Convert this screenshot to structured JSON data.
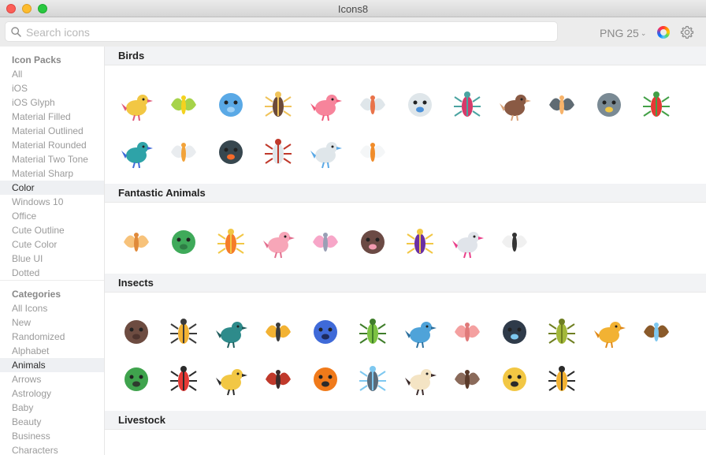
{
  "window": {
    "title": "Icons8"
  },
  "toolbar": {
    "search_placeholder": "Search icons",
    "format_label": "PNG 25",
    "format_chevron": "⌄"
  },
  "sidebar": {
    "icon_packs_header": "Icon Packs",
    "icon_packs": [
      "All",
      "iOS",
      "iOS Glyph",
      "Material Filled",
      "Material Outlined",
      "Material Rounded",
      "Material Two Tone",
      "Material Sharp",
      "Color",
      "Windows 10",
      "Office",
      "Cute Outline",
      "Cute Color",
      "Blue UI",
      "Dotted"
    ],
    "icon_packs_active": "Color",
    "categories_header": "Categories",
    "categories": [
      "All Icons",
      "New",
      "Randomized",
      "Alphabet",
      "Animals",
      "Arrows",
      "Astrology",
      "Baby",
      "Beauty",
      "Business",
      "Characters"
    ],
    "categories_active": "Animals"
  },
  "sections": [
    {
      "title": "Birds",
      "icons": [
        {
          "name": "singing-bird-icon",
          "color": "#f2c744",
          "accent": "#e05a7a"
        },
        {
          "name": "parrot-yellow-icon",
          "color": "#a6d34a",
          "accent": "#f4d21f"
        },
        {
          "name": "dove-icon",
          "color": "#5aa9e6",
          "accent": "#9fd0f5"
        },
        {
          "name": "eagle-icon",
          "color": "#6b4a3a",
          "accent": "#f0c35a"
        },
        {
          "name": "flamingo-icon",
          "color": "#f7849b",
          "accent": "#f05a7a"
        },
        {
          "name": "stork-icon",
          "color": "#dfe6ea",
          "accent": "#e9734a"
        },
        {
          "name": "stork-baby-icon",
          "color": "#dfe6ea",
          "accent": "#4a90d9"
        },
        {
          "name": "hummingbird-icon",
          "color": "#d63a6a",
          "accent": "#4aa3a1"
        },
        {
          "name": "kiwi-icon",
          "color": "#8a5a44",
          "accent": "#d9a37a"
        },
        {
          "name": "ostrich-icon",
          "color": "#5f6b73",
          "accent": "#f7b36a"
        },
        {
          "name": "owl-icon",
          "color": "#7a8a94",
          "accent": "#f2c744"
        },
        {
          "name": "macaw-icon",
          "color": "#e53935",
          "accent": "#43a047"
        },
        {
          "name": "peacock-icon",
          "color": "#2ea3a8",
          "accent": "#3f6ad8"
        },
        {
          "name": "pelican-icon",
          "color": "#e9ecef",
          "accent": "#f2a33a"
        },
        {
          "name": "puffin-icon",
          "color": "#37474f",
          "accent": "#f46b2a"
        },
        {
          "name": "crane-icon",
          "color": "#dfe6ea",
          "accent": "#c0392b"
        },
        {
          "name": "stork-carrying-icon",
          "color": "#dfe6ea",
          "accent": "#5aa9e6"
        },
        {
          "name": "swan-icon",
          "color": "#f4f6f7",
          "accent": "#f08c2a"
        }
      ]
    },
    {
      "title": "Fantastic Animals",
      "icons": [
        {
          "name": "hamster-icon",
          "color": "#f7c27a",
          "accent": "#e08a3a"
        },
        {
          "name": "dragon-icon",
          "color": "#3faa5a",
          "accent": "#2e7d45"
        },
        {
          "name": "phoenix-icon",
          "color": "#f57c2a",
          "accent": "#f2c744"
        },
        {
          "name": "pig-face-icon",
          "color": "#f7a6b8",
          "accent": "#e26f8f"
        },
        {
          "name": "unicorn-book-icon",
          "color": "#f7a6c8",
          "accent": "#9a9fb5"
        },
        {
          "name": "bat-face-icon",
          "color": "#6b4a44",
          "accent": "#f29bb0"
        },
        {
          "name": "dodo-icon",
          "color": "#6a2fa3",
          "accent": "#f2c744"
        },
        {
          "name": "unicorn-icon",
          "color": "#e0e4ea",
          "accent": "#ea3f8a"
        },
        {
          "name": "zebra-icon",
          "color": "#f0f0f0",
          "accent": "#333333"
        }
      ]
    },
    {
      "title": "Insects",
      "icons": [
        {
          "name": "ant-icon",
          "color": "#6d4c41",
          "accent": "#4e342e"
        },
        {
          "name": "wasp-icon",
          "color": "#f2b233",
          "accent": "#3b3b3b"
        },
        {
          "name": "beetle-teal-icon",
          "color": "#2e8b8b",
          "accent": "#1e5c5c"
        },
        {
          "name": "bee-icon",
          "color": "#f2b233",
          "accent": "#3b3b3b"
        },
        {
          "name": "butterfly-blue-icon",
          "color": "#3f6ad8",
          "accent": "#1e2b5c"
        },
        {
          "name": "caterpillar-icon",
          "color": "#7cc243",
          "accent": "#3f7d2a"
        },
        {
          "name": "dragonfly-icon",
          "color": "#4fa3d9",
          "accent": "#2b6f9e"
        },
        {
          "name": "worm-icon",
          "color": "#f4a0a0",
          "accent": "#e07a7a"
        },
        {
          "name": "fly-icon",
          "color": "#2f3b4a",
          "accent": "#7ec8f0"
        },
        {
          "name": "grasshopper-icon",
          "color": "#a3b83a",
          "accent": "#6f7f22"
        },
        {
          "name": "beehive-icon",
          "color": "#f2b233",
          "accent": "#e08a1a"
        },
        {
          "name": "mosquito-icon",
          "color": "#8a5a2a",
          "accent": "#7ec8f0"
        },
        {
          "name": "scarab-icon",
          "color": "#3fa34d",
          "accent": "#2e3b2e"
        },
        {
          "name": "ladybug-icon",
          "color": "#e53935",
          "accent": "#2b2b2b"
        },
        {
          "name": "swallowtail-icon",
          "color": "#f2c744",
          "accent": "#2b2b2b"
        },
        {
          "name": "tick-icon",
          "color": "#c0392b",
          "accent": "#3b2b2b"
        },
        {
          "name": "monarch-butterfly-icon",
          "color": "#f07a1a",
          "accent": "#2b2b2b"
        },
        {
          "name": "mosquito-blue-icon",
          "color": "#5a6b7a",
          "accent": "#7ec8f0"
        },
        {
          "name": "moth-icon",
          "color": "#f4e4c4",
          "accent": "#3b2b2b"
        },
        {
          "name": "spider-icon",
          "color": "#8a6a5a",
          "accent": "#5a3a2a"
        },
        {
          "name": "tiger-butterfly-icon",
          "color": "#f2c744",
          "accent": "#2b2b2b"
        },
        {
          "name": "hornet-icon",
          "color": "#f2b233",
          "accent": "#2b2b2b"
        }
      ]
    },
    {
      "title": "Livestock",
      "icons": []
    }
  ]
}
